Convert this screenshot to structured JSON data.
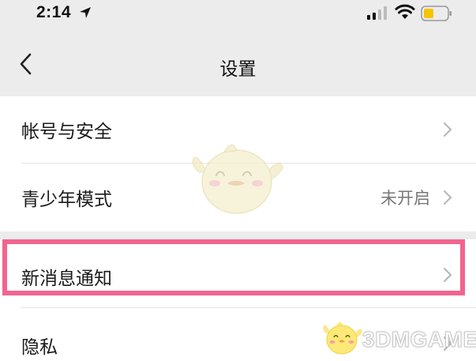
{
  "status_bar": {
    "time": "2:14",
    "icons": [
      "location-arrow-icon",
      "cellular-signal-icon",
      "wifi-icon",
      "battery-low-icon"
    ],
    "battery_color": "#f5c400"
  },
  "nav": {
    "title": "设置",
    "back_icon": "chevron-left-icon"
  },
  "settings": {
    "items": [
      {
        "label": "帐号与安全",
        "value": ""
      },
      {
        "label": "青少年模式",
        "value": "未开启"
      },
      {
        "label": "新消息通知",
        "value": "",
        "highlighted": true
      },
      {
        "label": "隐私",
        "value": ""
      }
    ]
  },
  "colors": {
    "background": "#ececec",
    "list_background": "#ffffff",
    "highlight_border": "#f2648e"
  },
  "watermark": {
    "text": "3DMGAME"
  }
}
